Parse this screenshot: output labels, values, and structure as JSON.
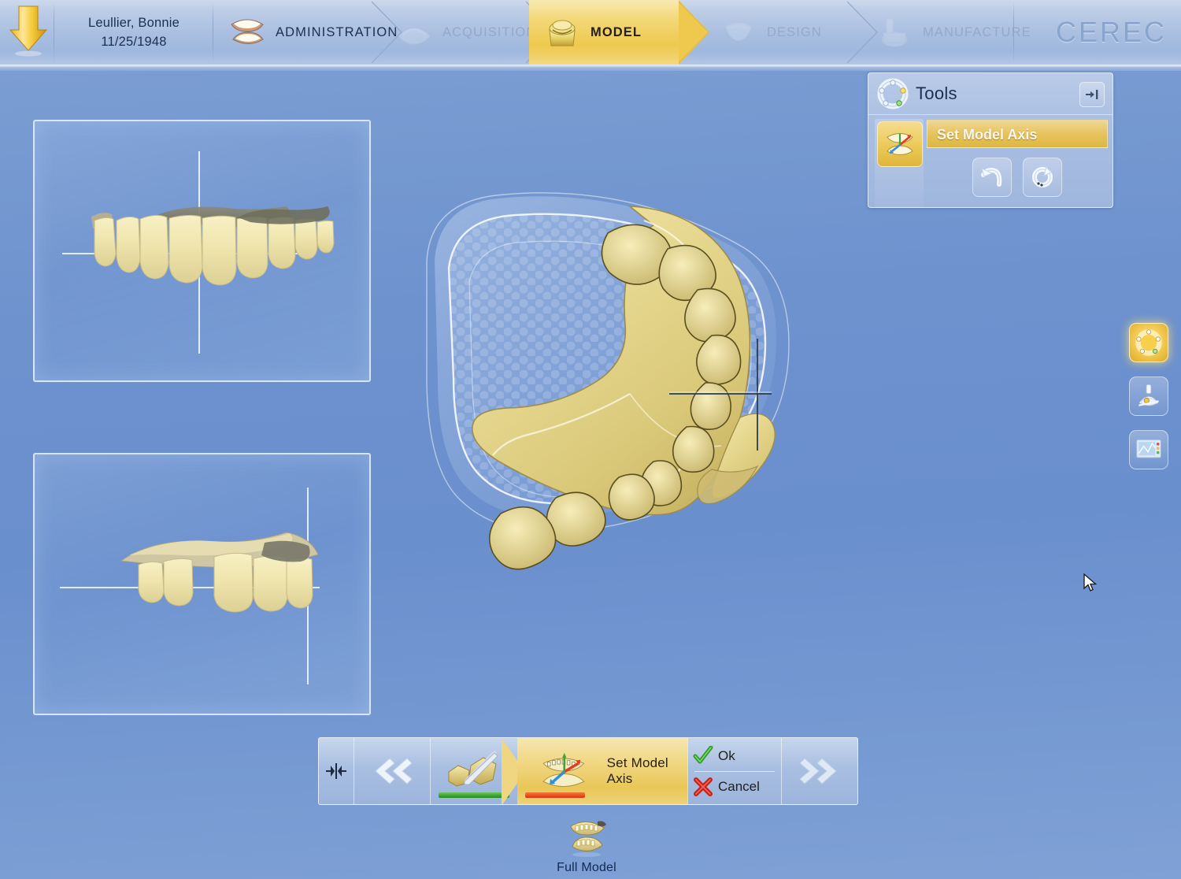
{
  "app": {
    "brand": "CEREC",
    "background_color": "#6e92ce",
    "accent_gold": "#eec94e"
  },
  "header": {
    "back_icon": "down-arrow-icon",
    "patient": {
      "name": "Leullier, Bonnie",
      "birthdate": "11/25/1948"
    },
    "steps": [
      {
        "label": "ADMINISTRATION",
        "icon": "dental-model-icon",
        "state": "solid"
      },
      {
        "label": "ACQUISITION",
        "icon": "impression-icon",
        "state": "dim"
      },
      {
        "label": "MODEL",
        "icon": "die-model-icon",
        "state": "active"
      },
      {
        "label": "DESIGN",
        "icon": "crown-design-icon",
        "state": "dim"
      },
      {
        "label": "MANUFACTURE",
        "icon": "milling-unit-icon",
        "state": "dim"
      }
    ]
  },
  "tools": {
    "title": "Tools",
    "header_icon": "tools-ring-icon",
    "collapse_icon": "collapse-right-icon",
    "active_tool_icon": "set-model-axis-icon",
    "selected_tool": "Set Model Axis",
    "undo_icon": "undo-icon",
    "redo_icon": "redo-icon"
  },
  "rail": [
    {
      "name": "tools-ring-icon",
      "active": true
    },
    {
      "name": "articulator-icon",
      "active": false
    },
    {
      "name": "display-settings-icon",
      "active": false
    }
  ],
  "previews": [
    {
      "name": "frontal-view",
      "view": "anterior"
    },
    {
      "name": "lateral-view",
      "view": "buccal"
    }
  ],
  "viewport": {
    "model": "mandibular-arch-3d",
    "overlay": "arch-template-outline",
    "axis_indicator": "model-axis-crosshair",
    "cursor": "pointer-arrow"
  },
  "step_bar": {
    "center_icon": "center-model-icon",
    "prev_icon": "double-chevron-left-icon",
    "next_icon": "double-chevron-right-icon",
    "done_step": {
      "icon": "edit-model-icon",
      "progress": "complete",
      "progress_color": "#2f9a25"
    },
    "active_step": {
      "icon": "set-model-axis-icon",
      "label": "Set Model Axis",
      "progress": "in-progress",
      "progress_color": "#e0320d"
    },
    "ok_label": "Ok",
    "ok_icon": "green-check-icon",
    "cancel_label": "Cancel",
    "cancel_icon": "red-cross-icon"
  },
  "full_model": {
    "label": "Full Model",
    "icon": "full-model-jaws-icon"
  }
}
